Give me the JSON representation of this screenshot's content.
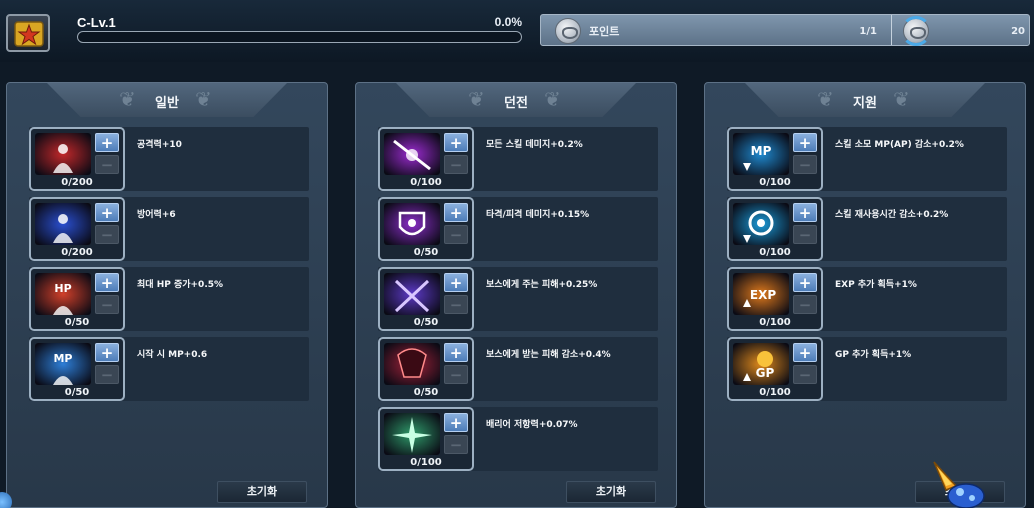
{
  "header": {
    "level_label": "C-Lv.1",
    "exp_percent_label": "0.0%",
    "exp_progress": 0.0,
    "points_label": "포인트",
    "points_value": "1/1",
    "reset_count": "20"
  },
  "panels": [
    {
      "title": "일반",
      "reset_label": "초기화",
      "skills": [
        {
          "icon": "attack-icon",
          "level": "0/200",
          "desc": "공격력+10",
          "color": "#c2282a"
        },
        {
          "icon": "defense-icon",
          "level": "0/200",
          "desc": "방어력+6",
          "color": "#2a4fd0"
        },
        {
          "icon": "hp-icon",
          "level": "0/50",
          "desc": "최대 HP 증가+0.5%",
          "color": "#d1402a"
        },
        {
          "icon": "mp-icon",
          "level": "0/50",
          "desc": "시작 시 MP+0.6",
          "color": "#2e7fd8"
        }
      ]
    },
    {
      "title": "던전",
      "reset_label": "초기화",
      "skills": [
        {
          "icon": "all-skill-damage-icon",
          "level": "0/100",
          "desc": "모든 스킬 데미지+0.2%",
          "color": "#9b2bd0"
        },
        {
          "icon": "hit-damage-icon",
          "level": "0/50",
          "desc": "타격/피격 데미지+0.15%",
          "color": "#8a2ec8"
        },
        {
          "icon": "boss-damage-icon",
          "level": "0/50",
          "desc": "보스에게 주는 피해+0.25%",
          "color": "#5d3ac8"
        },
        {
          "icon": "boss-defense-icon",
          "level": "0/50",
          "desc": "보스에게 받는 피해 감소+0.4%",
          "color": "#a3223a"
        },
        {
          "icon": "barrier-icon",
          "level": "0/100",
          "desc": "배리어 저항력+0.07%",
          "color": "#2f9a6a"
        }
      ]
    },
    {
      "title": "지원",
      "reset_label": "초기화",
      "skills": [
        {
          "icon": "mp-cost-icon",
          "level": "0/100",
          "desc": "스킬 소모 MP(AP) 감소+0.2%",
          "color": "#1f8ad0"
        },
        {
          "icon": "cooldown-icon",
          "level": "0/100",
          "desc": "스킬 재사용시간 감소+0.2%",
          "color": "#1a9ad8"
        },
        {
          "icon": "exp-icon",
          "level": "0/100",
          "desc": "EXP 추가 획득+1%",
          "color": "#e07a1c"
        },
        {
          "icon": "gp-icon",
          "level": "0/100",
          "desc": "GP 추가 획득+1%",
          "color": "#e08a1c"
        }
      ]
    }
  ]
}
